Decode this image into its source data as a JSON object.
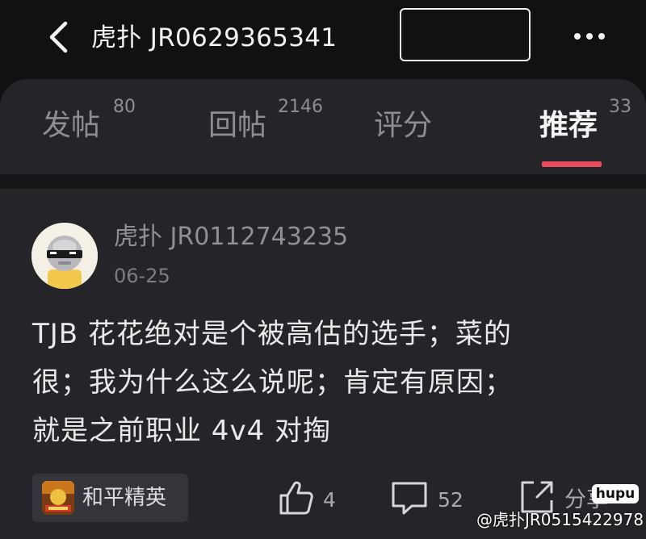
{
  "header": {
    "title": "虎扑 JR0629365341",
    "back_icon": "chevron-left-icon",
    "more_icon": "more-horizontal-icon"
  },
  "tabs": [
    {
      "label": "发帖",
      "count": "80",
      "active": false
    },
    {
      "label": "回帖",
      "count": "2146",
      "active": false
    },
    {
      "label": "评分",
      "count": "",
      "active": false
    },
    {
      "label": "推荐",
      "count": "33",
      "active": true
    }
  ],
  "post": {
    "author": "虎扑 JR0112743235",
    "date": "06-25",
    "body_lines": [
      "TJB 花花绝对是个被高估的选手；菜的",
      "很；我为什么这么说呢；肯定有原因；",
      "就是之前职业 4v4 对掏"
    ],
    "game_tag": "和平精英",
    "likes": "4",
    "comments": "52",
    "share_label": "分享"
  },
  "watermark": {
    "logo_text": "hupu",
    "text": "@虎扑JR0515422978"
  },
  "colors": {
    "background": "#111113",
    "card": "#252529",
    "accent_underline": "#e64a5c"
  }
}
